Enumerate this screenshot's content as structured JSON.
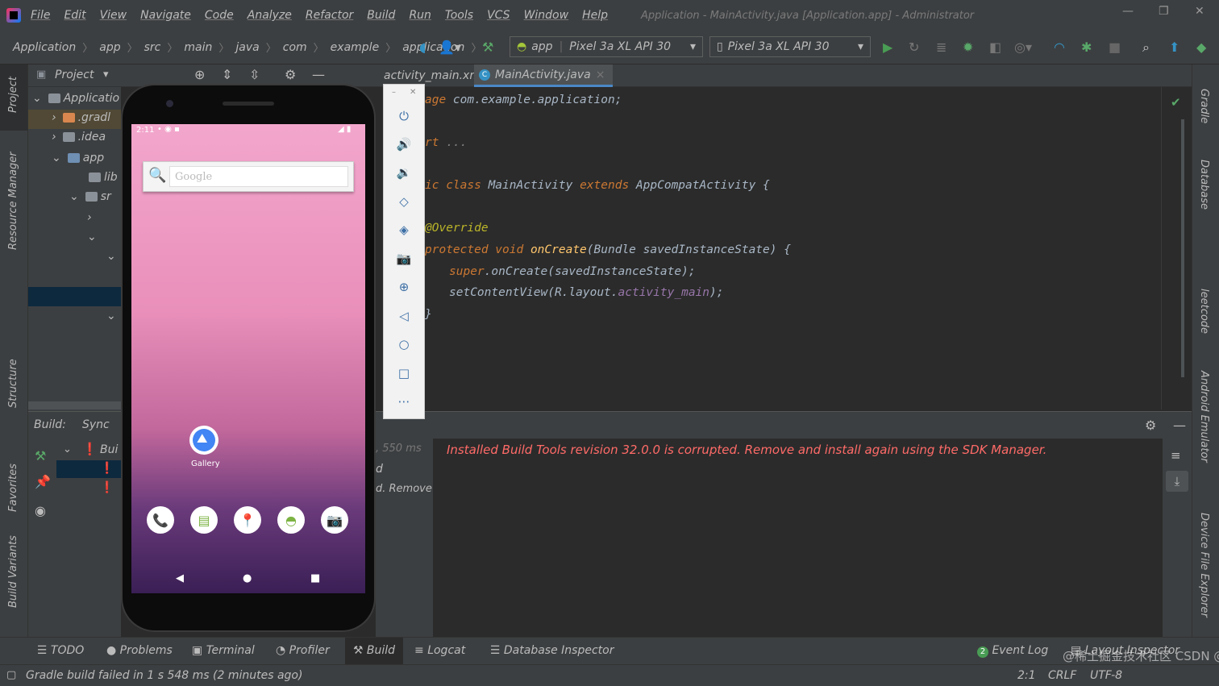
{
  "menu": {
    "items": [
      "File",
      "Edit",
      "View",
      "Navigate",
      "Code",
      "Analyze",
      "Refactor",
      "Build",
      "Run",
      "Tools",
      "VCS",
      "Window",
      "Help"
    ],
    "title": "Application - MainActivity.java [Application.app] - Administrator"
  },
  "breadcrumb": [
    "Application",
    "app",
    "src",
    "main",
    "java",
    "com",
    "example",
    "application"
  ],
  "toolbar": {
    "run_config": "app",
    "device_selector": "Pixel 3a XL API 30",
    "device_combo": "Pixel 3a XL API 30"
  },
  "left_stripe": {
    "project": "Project",
    "resource_manager": "Resource Manager",
    "structure": "Structure",
    "favorites": "Favorites",
    "build_variants": "Build Variants"
  },
  "project_panel": {
    "title": "Project",
    "rows": [
      "Applicatio",
      ".gradl",
      ".idea",
      "app",
      "lib",
      "sr"
    ]
  },
  "editor": {
    "tabs": [
      {
        "label": "activity_main.xml",
        "active": false
      },
      {
        "label": "MainActivity.java",
        "active": true
      }
    ],
    "lines": {
      "l1a": "age ",
      "l1b": "com.example.application;",
      "l2a": "rt ",
      "l2b": "...",
      "l3a": "ic class ",
      "l3b": "MainActivity ",
      "l3c": "extends ",
      "l3d": "AppCompatActivity {",
      "l4": "@Override",
      "l5a": "protected void ",
      "l5b": "onCreate",
      "l5c": "(Bundle savedInstanceState) {",
      "l6a": "super",
      "l6b": ".onCreate(savedInstanceState);",
      "l7a": "setContentView(R.layout.",
      "l7b": "activity_main",
      "l7c": ");",
      "l8": "}"
    }
  },
  "build_panel": {
    "label": "Build:",
    "sync": "Sync",
    "tree_root": "Bui",
    "timing": ", 550 ms",
    "partial_1": "d",
    "partial_2": "d. Remove",
    "error_message": "Installed Build Tools revision 32.0.0 is corrupted. Remove and install again using the SDK Manager."
  },
  "right_stripe": {
    "gradle": "Gradle",
    "database": "Database",
    "leetcode": "leetcode",
    "android_emulator": "Android Emulator",
    "device_file_explorer": "Device File Explorer"
  },
  "bottom_tools": {
    "todo": "TODO",
    "problems": "Problems",
    "terminal": "Terminal",
    "profiler": "Profiler",
    "build": "Build",
    "logcat": "Logcat",
    "database_inspector": "Database Inspector",
    "event_log": "Event Log",
    "event_log_count": "2",
    "layout_inspector": "Layout Inspector"
  },
  "status": {
    "message": "Gradle build failed in 1 s 548 ms (2 minutes ago)",
    "position": "2:1",
    "line_sep": "CRLF",
    "encoding": "UTF-8",
    "watermark": "@稀土掘金技术社区 CSDN @lk爱儒"
  },
  "emulator": {
    "time": "2:11",
    "search_placeholder": "Google",
    "gallery_label": "Gallery"
  },
  "colors": {
    "error": "#ff6b68",
    "keyword": "#cc7832",
    "function": "#ffc66d",
    "annotation": "#bbb529",
    "purple": "#9876aa"
  }
}
